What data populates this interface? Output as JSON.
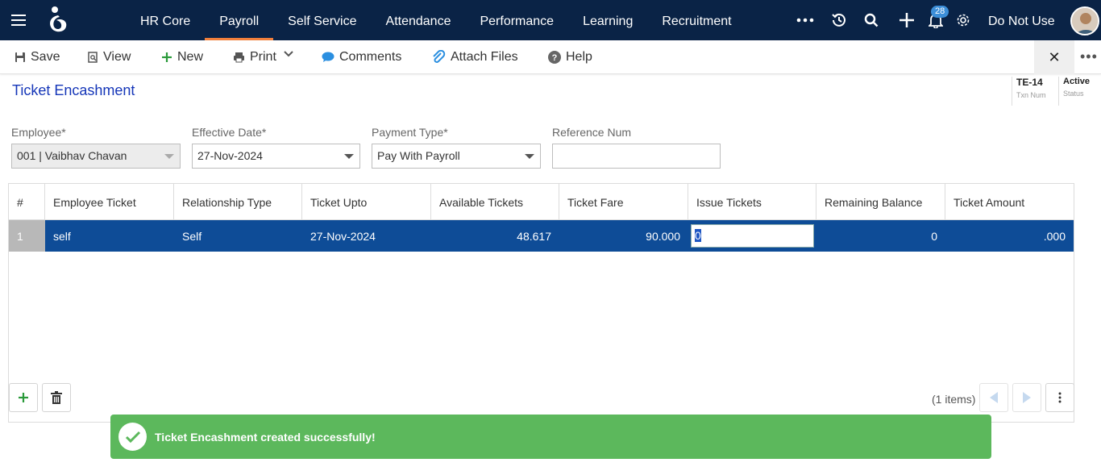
{
  "nav": {
    "items": [
      "HR Core",
      "Payroll",
      "Self Service",
      "Attendance",
      "Performance",
      "Learning",
      "Recruitment"
    ],
    "active": "Payroll",
    "notification_count": "28",
    "user_name": "Do Not Use"
  },
  "toolbar": {
    "save": "Save",
    "view": "View",
    "new": "New",
    "print": "Print",
    "comments": "Comments",
    "attach": "Attach Files",
    "help": "Help",
    "close": "✕",
    "more": "•••"
  },
  "page": {
    "title": "Ticket Encashment",
    "txn_num": "TE-14",
    "txn_num_label": "Txn Num",
    "status": "Active",
    "status_label": "Status"
  },
  "form": {
    "employee_label": "Employee*",
    "employee_value": "001 | Vaibhav Chavan",
    "effective_date_label": "Effective Date*",
    "effective_date_value": "27-Nov-2024",
    "payment_type_label": "Payment Type*",
    "payment_type_value": "Pay With Payroll",
    "reference_label": "Reference Num",
    "reference_value": ""
  },
  "grid": {
    "headers": [
      "#",
      "Employee Ticket",
      "Relationship Type",
      "Ticket Upto",
      "Available Tickets",
      "Ticket Fare",
      "Issue Tickets",
      "Remaining Balance",
      "Ticket Amount"
    ],
    "rows": [
      {
        "num": "1",
        "employee_ticket": "self",
        "relationship": "Self",
        "ticket_upto": "27-Nov-2024",
        "available": "48.617",
        "fare": "90.000",
        "issue": "0",
        "remaining": "0",
        "amount": ".000"
      }
    ],
    "items_count": "(1 items)"
  },
  "toast": {
    "message": "Ticket Encashment created successfully!"
  },
  "colors": {
    "nav_bg": "#0a2346",
    "accent": "#f07f3c",
    "selected_row": "#0e4c97",
    "toast": "#5cb85c",
    "title": "#1536b8"
  }
}
